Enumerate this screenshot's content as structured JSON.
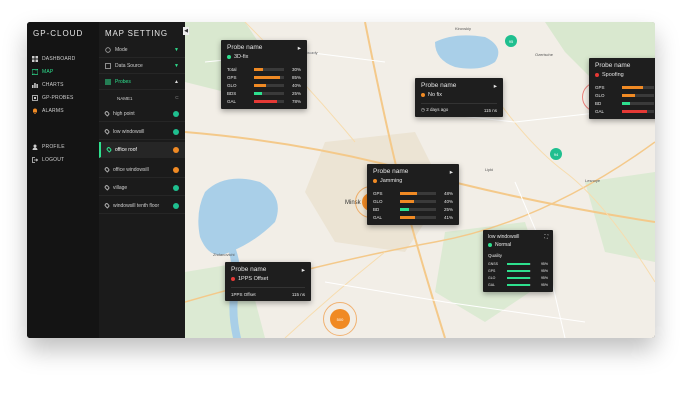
{
  "app": {
    "title": "GP-CLOUD"
  },
  "sidebar": {
    "items": [
      {
        "label": "DASHBOARD",
        "icon": "grid-icon"
      },
      {
        "label": "MAP",
        "icon": "map-icon",
        "active": true
      },
      {
        "label": "CHARTS",
        "icon": "chart-icon"
      },
      {
        "label": "GP-PROBES",
        "icon": "probe-icon"
      },
      {
        "label": "ALARMS",
        "icon": "alarm-icon"
      }
    ],
    "footer": [
      {
        "label": "PROFILE",
        "icon": "user-icon"
      },
      {
        "label": "LOGOUT",
        "icon": "logout-icon"
      }
    ]
  },
  "panel": {
    "title": "MAP SETTING",
    "sections": [
      {
        "label": "Mode"
      },
      {
        "label": "Data Source"
      },
      {
        "label": "Probes"
      }
    ],
    "name_label": "NAME1",
    "probes": [
      {
        "label": "high point",
        "status": "teal"
      },
      {
        "label": "low windowsill",
        "status": "teal"
      },
      {
        "label": "office roof",
        "status": "orange",
        "selected": true
      },
      {
        "label": "office windowsill",
        "status": "orange"
      },
      {
        "label": "village",
        "status": "teal"
      },
      {
        "label": "windowsill tenth floor",
        "status": "teal"
      }
    ]
  },
  "colors": {
    "accent": "#2ee08e",
    "orange": "#f08a24",
    "red": "#e53935",
    "teal": "#1fbf8f",
    "card_bg": "#1e1e1e"
  },
  "map_labels": [
    "Kirovskiy",
    "Zhdanovichi",
    "Minsk",
    "Lesnoye",
    "Ozerische",
    "Lipki",
    "Drozdy"
  ],
  "markers": [
    {
      "label": "95",
      "color": "teal"
    },
    {
      "label": "95",
      "color": "teal"
    },
    {
      "label": "No fix",
      "color": "black"
    },
    {
      "label": "60",
      "color": "red"
    },
    {
      "label": "70",
      "color": "orange"
    },
    {
      "label": "94",
      "color": "teal"
    },
    {
      "label": "1PPS",
      "color": "red"
    },
    {
      "label": "500",
      "color": "orange"
    },
    {
      "label": "94",
      "color": "teal"
    }
  ],
  "cards": {
    "c3d": {
      "title": "Probe name",
      "status": "3D-fix",
      "rows": [
        {
          "label": "Total",
          "value": "30%",
          "pct": 30,
          "color": "#f08a24"
        },
        {
          "label": "GPS",
          "value": "85%",
          "pct": 85,
          "color": "#f08a24"
        },
        {
          "label": "GLO",
          "value": "40%",
          "pct": 40,
          "color": "#f08a24"
        },
        {
          "label": "BDS",
          "value": "25%",
          "pct": 25,
          "color": "#2ee08e"
        },
        {
          "label": "GAL",
          "value": "78%",
          "pct": 78,
          "color": "#e53935"
        }
      ]
    },
    "nofix": {
      "title": "Probe name",
      "status": "No fix",
      "time": "2 days ago",
      "rate": "115 ns"
    },
    "spoof": {
      "title": "Probe name",
      "status": "Spoofing",
      "rows": [
        {
          "label": "GPS",
          "value": "65%",
          "pct": 65,
          "color": "#f08a24"
        },
        {
          "label": "GLO",
          "value": "40%",
          "pct": 40,
          "color": "#f08a24"
        },
        {
          "label": "BD",
          "value": "25%",
          "pct": 25,
          "color": "#2ee08e"
        },
        {
          "label": "GAL",
          "value": "78%",
          "pct": 78,
          "color": "#e53935"
        }
      ]
    },
    "jam": {
      "title": "Probe name",
      "status": "Jamming",
      "rows": [
        {
          "label": "GPS",
          "value": "48%",
          "pct": 48,
          "color": "#f08a24"
        },
        {
          "label": "GLO",
          "value": "40%",
          "pct": 40,
          "color": "#f08a24"
        },
        {
          "label": "BD",
          "value": "25%",
          "pct": 25,
          "color": "#2ee08e"
        },
        {
          "label": "GAL",
          "value": "41%",
          "pct": 41,
          "color": "#f08a24"
        }
      ]
    },
    "pps": {
      "title": "Probe name",
      "status": "1PPS Offset",
      "row_label": "1PPS Offset",
      "row_value": "115 ns"
    },
    "lw": {
      "title": "low windowsill",
      "status": "Normal",
      "quality": "Quality",
      "rows": [
        {
          "label": "GNSS",
          "value": "95%",
          "pct": 95,
          "color": "#2ee08e"
        },
        {
          "label": "GPS",
          "value": "95%",
          "pct": 95,
          "color": "#2ee08e"
        },
        {
          "label": "GLO",
          "value": "95%",
          "pct": 95,
          "color": "#2ee08e"
        },
        {
          "label": "GAL",
          "value": "95%",
          "pct": 95,
          "color": "#2ee08e"
        }
      ]
    }
  },
  "zoom": {
    "in": "+",
    "out": "−"
  }
}
